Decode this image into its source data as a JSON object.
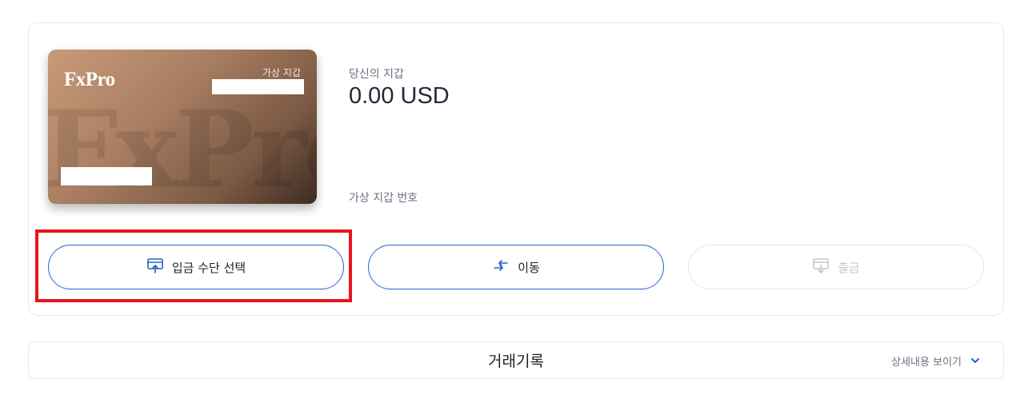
{
  "card": {
    "logo": "FxPro",
    "watermark": "FxPro",
    "type_label": "가상 지갑"
  },
  "wallet": {
    "label": "당신의 지갑",
    "balance": "0.00 USD",
    "number_label": "가상 지갑 번호"
  },
  "actions": {
    "deposit": {
      "label": "입금 수단 선택",
      "icon": "deposit-upload-icon"
    },
    "transfer": {
      "label": "이동",
      "icon": "transfer-arrows-icon"
    },
    "withdraw": {
      "label": "출금",
      "icon": "withdraw-download-icon"
    }
  },
  "history": {
    "title": "거래기록",
    "toggle_label": "상세내용 보이기",
    "toggle_icon": "chevron-down-icon"
  },
  "colors": {
    "accent": "#2563c9",
    "highlight": "#e8141c",
    "disabled": "#c4c7cc"
  }
}
